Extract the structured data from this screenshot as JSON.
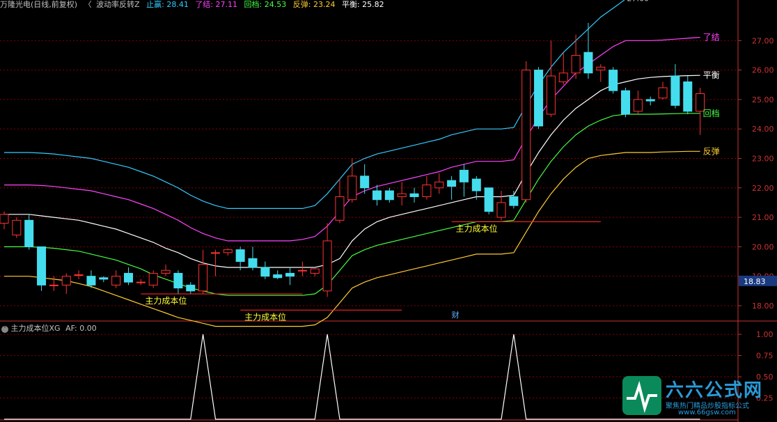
{
  "header": {
    "stock": "万隆光电(日线,前复权)",
    "indicator": "波动率反转Z",
    "items": [
      {
        "label": "止赢: 28.41",
        "color": "#33ccff"
      },
      {
        "label": "了结: 27.11",
        "color": "#ff44ff"
      },
      {
        "label": "回档: 24.53",
        "color": "#44ff44"
      },
      {
        "label": "反弹: 23.24",
        "color": "#ffcc33"
      },
      {
        "label": "平衡: 25.82",
        "color": "#ffffff"
      }
    ]
  },
  "sub_header": {
    "name": "主力成本位XG",
    "af": "AF: 0.00"
  },
  "watermark": {
    "title": "六六公式网",
    "slogan": "聚焦热门精品炒股指标公式",
    "url": "www.66gsw.com"
  },
  "colors": {
    "up": "#ff3333",
    "down": "#44ddee",
    "grid": "#880000",
    "axis": "#cc3333"
  },
  "chart_data": [
    {
      "type": "candlestick",
      "y_ticks": [
        18.0,
        19.0,
        20.0,
        21.0,
        22.0,
        23.0,
        24.0,
        25.0,
        26.0,
        27.0
      ],
      "ylim": [
        17.55,
        28.0
      ],
      "current_price": "18.83",
      "high_marker": "27.60",
      "event_marker": "财",
      "candles": [
        [
          20.8,
          21.1,
          21.2,
          20.6
        ],
        [
          20.4,
          20.9,
          21.0,
          20.3
        ],
        [
          20.9,
          20.0,
          21.1,
          19.9
        ],
        [
          20.0,
          18.7,
          20.0,
          18.5
        ],
        [
          18.7,
          18.7,
          19.0,
          18.5
        ],
        [
          18.7,
          19.0,
          19.1,
          18.4
        ],
        [
          19.05,
          19.05,
          19.2,
          18.9
        ],
        [
          19.0,
          18.7,
          19.2,
          18.6
        ],
        [
          18.95,
          18.9,
          19.0,
          18.8
        ],
        [
          18.7,
          19.0,
          19.2,
          18.6
        ],
        [
          19.1,
          18.8,
          19.3,
          18.7
        ],
        [
          18.8,
          18.8,
          18.9,
          18.7
        ],
        [
          18.7,
          19.1,
          19.2,
          18.6
        ],
        [
          19.1,
          19.2,
          19.4,
          19.0
        ],
        [
          19.1,
          18.6,
          19.2,
          18.4
        ],
        [
          18.7,
          18.5,
          18.8,
          18.4
        ],
        [
          18.5,
          19.4,
          19.9,
          18.4
        ],
        [
          19.8,
          19.8,
          19.9,
          19.0
        ],
        [
          19.8,
          19.9,
          19.95,
          19.7
        ],
        [
          19.9,
          19.5,
          20.0,
          19.2
        ],
        [
          19.6,
          19.3,
          20.0,
          19.2
        ],
        [
          19.3,
          19.0,
          19.5,
          18.9
        ],
        [
          19.05,
          18.95,
          19.2,
          18.9
        ],
        [
          19.1,
          19.0,
          19.3,
          18.7
        ],
        [
          19.2,
          19.2,
          19.5,
          19.0
        ],
        [
          19.1,
          19.25,
          19.3,
          19.0
        ],
        [
          18.5,
          20.2,
          20.8,
          18.3
        ],
        [
          20.9,
          21.7,
          22.3,
          20.8
        ],
        [
          21.6,
          22.4,
          23.0,
          21.5
        ],
        [
          22.4,
          22.0,
          22.8,
          21.8
        ],
        [
          21.9,
          21.6,
          22.1,
          21.4
        ],
        [
          21.9,
          21.6,
          22.0,
          21.5
        ],
        [
          21.7,
          21.8,
          22.2,
          21.4
        ],
        [
          21.8,
          21.7,
          22.0,
          21.5
        ],
        [
          21.7,
          22.1,
          22.4,
          21.6
        ],
        [
          22.0,
          22.2,
          22.5,
          21.8
        ],
        [
          22.25,
          22.05,
          22.4,
          21.6
        ],
        [
          22.6,
          22.2,
          22.8,
          21.7
        ],
        [
          22.3,
          21.9,
          22.4,
          21.6
        ],
        [
          22.0,
          21.2,
          22.0,
          21.1
        ],
        [
          21.0,
          21.5,
          21.9,
          20.9
        ],
        [
          21.7,
          21.4,
          21.9,
          21.3
        ],
        [
          21.6,
          26.0,
          26.3,
          21.5
        ],
        [
          26.0,
          24.1,
          26.1,
          24.0
        ],
        [
          24.5,
          25.8,
          27.0,
          24.4
        ],
        [
          25.6,
          25.9,
          26.6,
          25.5
        ],
        [
          25.9,
          26.5,
          27.2,
          25.7
        ],
        [
          26.6,
          25.9,
          27.6,
          25.7
        ],
        [
          26.0,
          26.1,
          26.2,
          25.6
        ],
        [
          26.0,
          25.3,
          26.1,
          25.2
        ],
        [
          25.3,
          24.5,
          25.4,
          24.4
        ],
        [
          24.6,
          25.0,
          25.3,
          24.5
        ],
        [
          25.0,
          24.95,
          25.1,
          24.8
        ],
        [
          25.05,
          25.4,
          25.6,
          25.0
        ],
        [
          25.8,
          24.8,
          26.2,
          24.7
        ],
        [
          25.6,
          24.6,
          25.8,
          24.5
        ],
        [
          24.6,
          25.2,
          25.4,
          23.8
        ]
      ],
      "lines": [
        {
          "name": "止赢",
          "color": "#33ccff",
          "values": [
            23.2,
            23.2,
            23.2,
            23.18,
            23.15,
            23.1,
            23.05,
            23.0,
            22.9,
            22.8,
            22.7,
            22.55,
            22.4,
            22.2,
            22.0,
            21.75,
            21.55,
            21.4,
            21.3,
            21.3,
            21.3,
            21.3,
            21.3,
            21.3,
            21.3,
            21.4,
            21.8,
            22.3,
            22.8,
            23.0,
            23.15,
            23.25,
            23.35,
            23.45,
            23.55,
            23.65,
            23.8,
            23.9,
            24.0,
            24.0,
            24.0,
            24.05,
            24.8,
            25.5,
            26.1,
            26.6,
            27.0,
            27.4,
            27.8,
            28.1,
            28.41
          ]
        },
        {
          "name": "了结",
          "color": "#ff44ff",
          "values": [
            22.1,
            22.1,
            22.1,
            22.08,
            22.05,
            22.0,
            21.95,
            21.9,
            21.8,
            21.7,
            21.6,
            21.45,
            21.3,
            21.1,
            20.9,
            20.65,
            20.45,
            20.3,
            20.2,
            20.2,
            20.2,
            20.2,
            20.2,
            20.2,
            20.25,
            20.35,
            20.7,
            21.2,
            21.7,
            21.9,
            22.05,
            22.15,
            22.25,
            22.35,
            22.45,
            22.55,
            22.7,
            22.8,
            22.9,
            22.9,
            22.9,
            22.95,
            23.7,
            24.4,
            25.0,
            25.45,
            25.9,
            26.2,
            26.5,
            26.8,
            27.0,
            27.0,
            27.0,
            27.02,
            27.05,
            27.08,
            27.11
          ]
        },
        {
          "name": "平衡",
          "color": "#ffffff",
          "values": [
            21.1,
            21.1,
            21.1,
            21.05,
            21.0,
            20.95,
            20.9,
            20.8,
            20.7,
            20.6,
            20.45,
            20.3,
            20.15,
            19.95,
            19.8,
            19.6,
            19.45,
            19.35,
            19.3,
            19.3,
            19.3,
            19.3,
            19.3,
            19.3,
            19.3,
            19.3,
            19.4,
            19.6,
            20.2,
            20.6,
            20.85,
            21.0,
            21.1,
            21.2,
            21.3,
            21.4,
            21.5,
            21.6,
            21.7,
            21.7,
            21.7,
            21.75,
            22.5,
            23.2,
            23.8,
            24.3,
            24.7,
            25.0,
            25.3,
            25.5,
            25.6,
            25.7,
            25.75,
            25.78,
            25.8,
            25.81,
            25.82
          ]
        },
        {
          "name": "回档",
          "color": "#44ff44",
          "values": [
            20.0,
            20.0,
            20.0,
            19.98,
            19.95,
            19.9,
            19.85,
            19.75,
            19.65,
            19.55,
            19.4,
            19.25,
            19.05,
            18.9,
            18.75,
            18.6,
            18.5,
            18.4,
            18.35,
            18.35,
            18.35,
            18.35,
            18.35,
            18.35,
            18.35,
            18.4,
            18.7,
            19.2,
            19.7,
            19.9,
            20.05,
            20.15,
            20.25,
            20.35,
            20.45,
            20.55,
            20.65,
            20.75,
            20.85,
            20.85,
            20.85,
            20.9,
            21.6,
            22.3,
            22.9,
            23.4,
            23.8,
            24.1,
            24.3,
            24.45,
            24.5,
            24.5,
            24.5,
            24.51,
            24.52,
            24.53,
            24.53
          ]
        },
        {
          "name": "反弹",
          "color": "#ffcc33",
          "values": [
            19.0,
            19.0,
            19.0,
            18.95,
            18.9,
            18.85,
            18.75,
            18.65,
            18.5,
            18.35,
            18.2,
            18.05,
            17.9,
            17.75,
            17.6,
            17.5,
            17.4,
            17.3,
            17.3,
            17.3,
            17.3,
            17.3,
            17.3,
            17.3,
            17.3,
            17.35,
            17.6,
            18.1,
            18.6,
            18.8,
            18.95,
            19.05,
            19.15,
            19.25,
            19.35,
            19.45,
            19.55,
            19.65,
            19.75,
            19.75,
            19.75,
            19.8,
            20.5,
            21.2,
            21.8,
            22.3,
            22.7,
            23.0,
            23.1,
            23.15,
            23.2,
            23.2,
            23.2,
            23.22,
            23.23,
            23.24,
            23.24
          ]
        }
      ],
      "line_labels": [
        "了结",
        "平衡",
        "回档",
        "反弹"
      ],
      "cost_lines": [
        {
          "label": "主力成本位",
          "y": 18.4,
          "x0": 11,
          "x1": 24
        },
        {
          "label": "主力成本位",
          "y": 17.85,
          "x0": 19,
          "x1": 32
        },
        {
          "label": "主力成本位",
          "y": 20.85,
          "x0": 36,
          "x1": 48
        }
      ]
    },
    {
      "type": "line",
      "name": "主力成本位XG",
      "y_ticks": [
        0.25,
        0.5,
        0.75,
        1.0
      ],
      "ylim": [
        0,
        1.05
      ],
      "signals": [
        16,
        26,
        41
      ]
    }
  ]
}
